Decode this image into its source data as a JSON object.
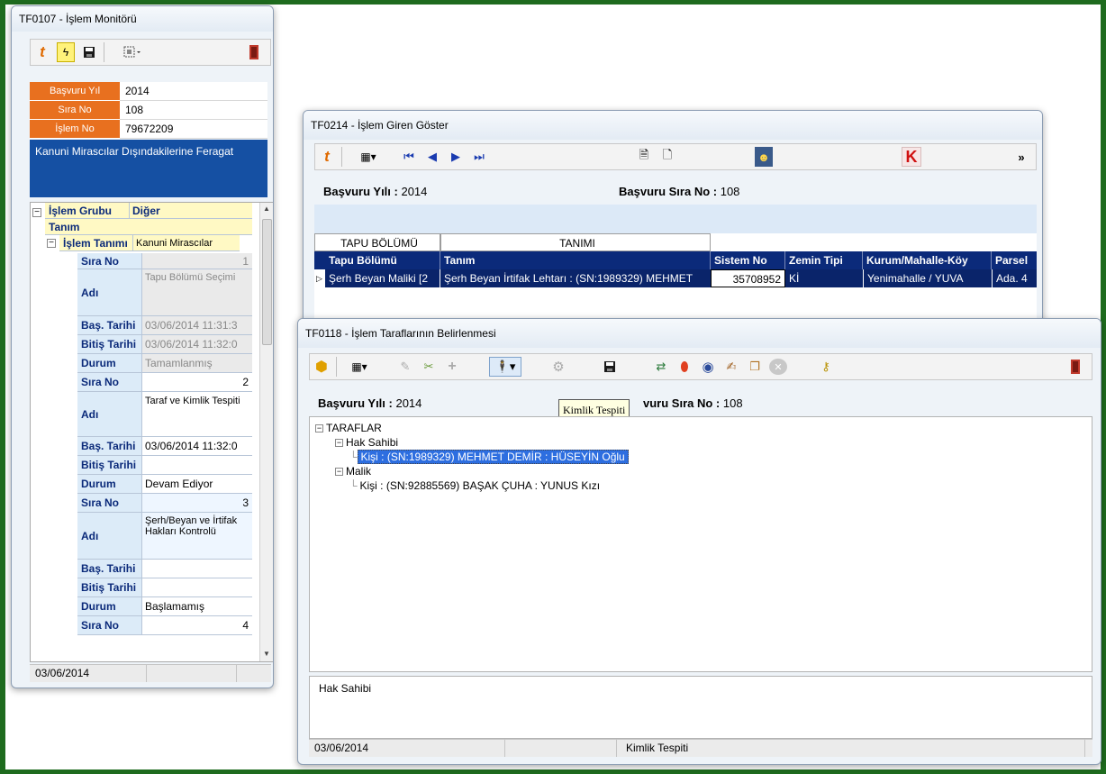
{
  "win1": {
    "title": "TF0107 - İşlem Monitörü",
    "fields": [
      {
        "label": "Başvuru Yıl",
        "value": "2014"
      },
      {
        "label": "Sıra No",
        "value": "108"
      },
      {
        "label": "İşlem No",
        "value": "79672209"
      }
    ],
    "description": "Kanuni Mirascılar Dışındakilerine Feragat",
    "grid": {
      "group_label": "İşlem Grubu",
      "group_value": "Diğer",
      "tanim_label": "Tanım",
      "islem_tanimi_label": "İşlem Tanımı",
      "islem_tanimi_value": "Kanuni Mirascılar",
      "steps": [
        {
          "sira_label": "Sıra No",
          "sira": "1",
          "adi_label": "Adı",
          "adi": "Tapu Bölümü Seçimi",
          "bas_label": "Baş. Tarihi",
          "bas": "03/06/2014 11:31:3",
          "bitis_label": "Bitiş Tarihi",
          "bitis": "03/06/2014 11:32:0",
          "durum_label": "Durum",
          "durum": "Tamamlanmış"
        },
        {
          "sira_label": "Sıra No",
          "sira": "2",
          "adi_label": "Adı",
          "adi": "Taraf ve Kimlik Tespiti",
          "bas_label": "Baş. Tarihi",
          "bas": "03/06/2014 11:32:0",
          "bitis_label": "Bitiş Tarihi",
          "bitis": "",
          "durum_label": "Durum",
          "durum": "Devam Ediyor"
        },
        {
          "sira_label": "Sıra No",
          "sira": "3",
          "adi_label": "Adı",
          "adi": "Şerh/Beyan ve İrtifak Hakları Kontrolü",
          "bas_label": "Baş. Tarihi",
          "bas": "",
          "bitis_label": "Bitiş Tarihi",
          "bitis": "",
          "durum_label": "Durum",
          "durum": "Başlamamış"
        },
        {
          "sira_label": "Sıra No",
          "sira": "4"
        }
      ]
    },
    "status_date": "03/06/2014"
  },
  "win2": {
    "title": "TF0214 - İşlem Giren Göster",
    "basvuru_yili_label": "Başvuru Yılı :",
    "basvuru_yili": "2014",
    "basvuru_sira_label": "Başvuru Sıra No :",
    "basvuru_sira": "108",
    "group_headers": [
      "TAPU BÖLÜMÜ",
      "TANIMI"
    ],
    "columns": [
      "Tapu Bölümü",
      "Tanım",
      "Sistem No",
      "Zemin Tipi",
      "Kurum/Mahalle-Köy",
      "Parsel"
    ],
    "rows": [
      [
        "Şerh Beyan Maliki [2",
        "Şerh Beyan İrtifak Lehtarı : (SN:1989329) MEHMET",
        "35708952",
        "Kİ",
        "Yenimahalle / YUVA",
        "Ada. 4"
      ]
    ],
    "chevron": "»"
  },
  "win3": {
    "title": "TF0118 - İşlem Taraflarının Belirlenmesi",
    "basvuru_yili_label": "Başvuru Yılı :",
    "basvuru_yili": "2014",
    "basvuru_sira_label": "vuru Sıra No :",
    "basvuru_sira": "108",
    "tooltip": "Kimlik Tespiti",
    "tree": {
      "root": "TARAFLAR",
      "hak_sahibi": "Hak Sahibi",
      "hak_sahibi_person": "Kişi : (SN:1989329) MEHMET DEMİR : HÜSEYİN Oğlu",
      "malik": "Malik",
      "malik_person": "Kişi : (SN:92885569) BAŞAK ÇUHA : YUNUS Kızı"
    },
    "memo": "Hak Sahibi",
    "status_date": "03/06/2014",
    "status_text": "Kimlik Tespiti"
  },
  "colors": {
    "orange_label": "#e8701f",
    "selection_blue": "#0a246a",
    "desktop_border": "#1e6b1e"
  }
}
